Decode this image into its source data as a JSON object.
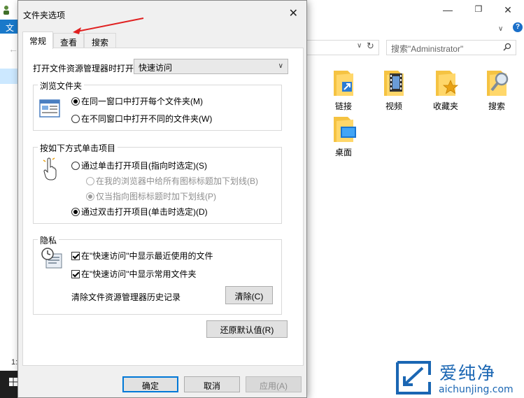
{
  "explorer": {
    "ribbon_tab": "文",
    "search_placeholder": "搜索\"Administrator\"",
    "item_count": "1:",
    "items": [
      {
        "name": "链接",
        "icon": "links-folder-icon"
      },
      {
        "name": "视频",
        "icon": "videos-folder-icon"
      },
      {
        "name": "收藏夹",
        "icon": "favorites-folder-icon"
      },
      {
        "name": "搜索",
        "icon": "searches-folder-icon"
      },
      {
        "name": "桌面",
        "icon": "desktop-folder-icon"
      }
    ]
  },
  "dialog": {
    "title": "文件夹选项",
    "tabs": [
      {
        "label": "常规",
        "active": true
      },
      {
        "label": "查看"
      },
      {
        "label": "搜索"
      }
    ],
    "open_explorer": {
      "label": "打开文件资源管理器时打开:",
      "value": "快速访问"
    },
    "browse": {
      "legend": "浏览文件夹",
      "options": [
        {
          "label": "在同一窗口中打开每个文件夹(M)",
          "checked": true
        },
        {
          "label": "在不同窗口中打开不同的文件夹(W)",
          "checked": false
        }
      ]
    },
    "click": {
      "legend": "按如下方式单击项目",
      "single": "通过单击打开项目(指向时选定)(S)",
      "sub_options": [
        {
          "label": "在我的浏览器中给所有图标标题加下划线(B)",
          "checked": false
        },
        {
          "label": "仅当指向图标标题时加下划线(P)",
          "checked": true
        }
      ],
      "double": "通过双击打开项目(单击时选定)(D)",
      "double_checked": true
    },
    "privacy": {
      "legend": "隐私",
      "checks": [
        {
          "label": "在\"快速访问\"中显示最近使用的文件",
          "checked": true
        },
        {
          "label": "在\"快速访问\"中显示常用文件夹",
          "checked": true
        }
      ],
      "clear_label": "清除文件资源管理器历史记录",
      "clear_button": "清除(C)"
    },
    "restore_button": "还原默认值(R)",
    "ok_button": "确定",
    "cancel_button": "取消",
    "apply_button": "应用(A)"
  },
  "watermark": {
    "cn": "爱纯净",
    "en": "aichunjing.com"
  },
  "colors": {
    "accent": "#0078d7",
    "annotation_arrow": "#e02020",
    "watermark": "#1a66b3"
  }
}
